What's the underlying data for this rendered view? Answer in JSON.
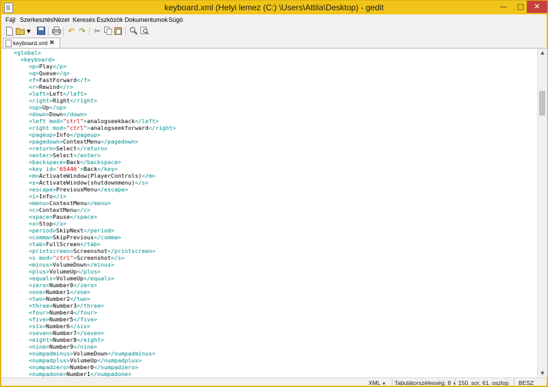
{
  "window": {
    "title": "keyboard.xml (Helyi lemez (C:) \\Users\\Attila\\Desktop) - gedit",
    "min_label": "—",
    "max_label": "□",
    "close_label": "✕"
  },
  "menu": [
    "Fájl",
    "Szerkesztés",
    "Nézet",
    "Keresés",
    "Eszközök",
    "Dokumentumok",
    "Súgó"
  ],
  "toolbar": {
    "icons": [
      "new-document-icon",
      "open-icon",
      "open-dropdown-icon",
      "save-icon",
      "print-icon",
      "undo-icon",
      "redo-icon",
      "cut-icon",
      "copy-icon",
      "paste-icon",
      "find-icon",
      "find-replace-icon"
    ]
  },
  "tab": {
    "label": "keyboard.xml",
    "close": "✖"
  },
  "lines": [
    [
      {
        "t": "tag",
        "s": "<global>"
      }
    ],
    [
      {
        "t": "tag",
        "s": "<keyboard>"
      }
    ],
    [
      {
        "t": "tag",
        "s": "<p>"
      },
      {
        "t": "txt",
        "s": "Play"
      },
      {
        "t": "tag",
        "s": "</p>"
      }
    ],
    [
      {
        "t": "tag",
        "s": "<q>"
      },
      {
        "t": "txt",
        "s": "Queue"
      },
      {
        "t": "tag",
        "s": "</q>"
      }
    ],
    [
      {
        "t": "tag",
        "s": "<f>"
      },
      {
        "t": "txt",
        "s": "FastForward"
      },
      {
        "t": "tag",
        "s": "</f>"
      }
    ],
    [
      {
        "t": "tag",
        "s": "<r>"
      },
      {
        "t": "txt",
        "s": "Rewind"
      },
      {
        "t": "tag",
        "s": "</r>"
      }
    ],
    [
      {
        "t": "tag",
        "s": "<left>"
      },
      {
        "t": "txt",
        "s": "Left"
      },
      {
        "t": "tag",
        "s": "</left>"
      }
    ],
    [
      {
        "t": "tag",
        "s": "<right>"
      },
      {
        "t": "txt",
        "s": "Right"
      },
      {
        "t": "tag",
        "s": "</right>"
      }
    ],
    [
      {
        "t": "tag",
        "s": "<up>"
      },
      {
        "t": "txt",
        "s": "Up"
      },
      {
        "t": "tag",
        "s": "</up>"
      }
    ],
    [
      {
        "t": "tag",
        "s": "<down>"
      },
      {
        "t": "txt",
        "s": "Down"
      },
      {
        "t": "tag",
        "s": "</down>"
      }
    ],
    [
      {
        "t": "tag",
        "s": "<left "
      },
      {
        "t": "attr",
        "s": "mod="
      },
      {
        "t": "val",
        "s": "\"ctrl\""
      },
      {
        "t": "tag",
        "s": ">"
      },
      {
        "t": "txt",
        "s": "analogseekback"
      },
      {
        "t": "tag",
        "s": "</left>"
      }
    ],
    [
      {
        "t": "tag",
        "s": "<right "
      },
      {
        "t": "attr",
        "s": "mod="
      },
      {
        "t": "val",
        "s": "\"ctrl\""
      },
      {
        "t": "tag",
        "s": ">"
      },
      {
        "t": "txt",
        "s": "analogseekforward"
      },
      {
        "t": "tag",
        "s": "</right>"
      }
    ],
    [
      {
        "t": "tag",
        "s": "<pageup>"
      },
      {
        "t": "txt",
        "s": "Info"
      },
      {
        "t": "tag",
        "s": "</pageup>"
      }
    ],
    [
      {
        "t": "tag",
        "s": "<pagedown>"
      },
      {
        "t": "txt",
        "s": "ContextMenu"
      },
      {
        "t": "tag",
        "s": "</pagedown>"
      }
    ],
    [
      {
        "t": "tag",
        "s": "<return>"
      },
      {
        "t": "txt",
        "s": "Select"
      },
      {
        "t": "tag",
        "s": "</return>"
      }
    ],
    [
      {
        "t": "tag",
        "s": "<enter>"
      },
      {
        "t": "txt",
        "s": "Select"
      },
      {
        "t": "tag",
        "s": "</enter>"
      }
    ],
    [
      {
        "t": "tag",
        "s": "<backspace>"
      },
      {
        "t": "txt",
        "s": "Back"
      },
      {
        "t": "tag",
        "s": "</backspace>"
      }
    ],
    [
      {
        "t": "tag",
        "s": "<key "
      },
      {
        "t": "attr",
        "s": "id="
      },
      {
        "t": "val",
        "s": "'65446'"
      },
      {
        "t": "tag",
        "s": ">"
      },
      {
        "t": "txt",
        "s": "Back"
      },
      {
        "t": "tag",
        "s": "</key>"
      }
    ],
    [
      {
        "t": "tag",
        "s": "<m>"
      },
      {
        "t": "txt",
        "s": "ActivateWindow(PlayerControls)"
      },
      {
        "t": "tag",
        "s": "</m>"
      }
    ],
    [
      {
        "t": "tag",
        "s": "<s>"
      },
      {
        "t": "txt",
        "s": "ActivateWindow(shutdownmenu)"
      },
      {
        "t": "tag",
        "s": "</s>"
      }
    ],
    [
      {
        "t": "tag",
        "s": "<escape>"
      },
      {
        "t": "txt",
        "s": "PreviousMenu"
      },
      {
        "t": "tag",
        "s": "</escape>"
      }
    ],
    [
      {
        "t": "tag",
        "s": "<i>"
      },
      {
        "t": "txt",
        "s": "Info"
      },
      {
        "t": "tag",
        "s": "</i>"
      }
    ],
    [
      {
        "t": "tag",
        "s": "<menu>"
      },
      {
        "t": "txt",
        "s": "ContextMenu"
      },
      {
        "t": "tag",
        "s": "</menu>"
      }
    ],
    [
      {
        "t": "tag",
        "s": "<c>"
      },
      {
        "t": "txt",
        "s": "ContextMenu"
      },
      {
        "t": "tag",
        "s": "</c>"
      }
    ],
    [
      {
        "t": "tag",
        "s": "<space>"
      },
      {
        "t": "txt",
        "s": "Pause"
      },
      {
        "t": "tag",
        "s": "</space>"
      }
    ],
    [
      {
        "t": "tag",
        "s": "<x>"
      },
      {
        "t": "txt",
        "s": "Stop"
      },
      {
        "t": "tag",
        "s": "</x>"
      }
    ],
    [
      {
        "t": "tag",
        "s": "<period>"
      },
      {
        "t": "txt",
        "s": "SkipNext"
      },
      {
        "t": "tag",
        "s": "</period>"
      }
    ],
    [
      {
        "t": "tag",
        "s": "<comma>"
      },
      {
        "t": "txt",
        "s": "SkipPrevious"
      },
      {
        "t": "tag",
        "s": "</comma>"
      }
    ],
    [
      {
        "t": "tag",
        "s": "<tab>"
      },
      {
        "t": "txt",
        "s": "FullScreen"
      },
      {
        "t": "tag",
        "s": "</tab>"
      }
    ],
    [
      {
        "t": "tag",
        "s": "<printscreen>"
      },
      {
        "t": "txt",
        "s": "Screenshot"
      },
      {
        "t": "tag",
        "s": "</printscreen>"
      }
    ],
    [
      {
        "t": "tag",
        "s": "<s "
      },
      {
        "t": "attr",
        "s": "mod="
      },
      {
        "t": "val",
        "s": "\"ctrl\""
      },
      {
        "t": "tag",
        "s": ">"
      },
      {
        "t": "txt",
        "s": "Screenshot"
      },
      {
        "t": "tag",
        "s": "</s>"
      }
    ],
    [
      {
        "t": "tag",
        "s": "<minus>"
      },
      {
        "t": "txt",
        "s": "VolumeDown"
      },
      {
        "t": "tag",
        "s": "</minus>"
      }
    ],
    [
      {
        "t": "tag",
        "s": "<plus>"
      },
      {
        "t": "txt",
        "s": "VolumeUp"
      },
      {
        "t": "tag",
        "s": "</plus>"
      }
    ],
    [
      {
        "t": "tag",
        "s": "<equals>"
      },
      {
        "t": "txt",
        "s": "VolumeUp"
      },
      {
        "t": "tag",
        "s": "</equals>"
      }
    ],
    [
      {
        "t": "tag",
        "s": "<zero>"
      },
      {
        "t": "txt",
        "s": "Number0"
      },
      {
        "t": "tag",
        "s": "</zero>"
      }
    ],
    [
      {
        "t": "tag",
        "s": "<one>"
      },
      {
        "t": "txt",
        "s": "Number1"
      },
      {
        "t": "tag",
        "s": "</one>"
      }
    ],
    [
      {
        "t": "tag",
        "s": "<two>"
      },
      {
        "t": "txt",
        "s": "Number2"
      },
      {
        "t": "tag",
        "s": "</two>"
      }
    ],
    [
      {
        "t": "tag",
        "s": "<three>"
      },
      {
        "t": "txt",
        "s": "Number3"
      },
      {
        "t": "tag",
        "s": "</three>"
      }
    ],
    [
      {
        "t": "tag",
        "s": "<four>"
      },
      {
        "t": "txt",
        "s": "Number4"
      },
      {
        "t": "tag",
        "s": "</four>"
      }
    ],
    [
      {
        "t": "tag",
        "s": "<five>"
      },
      {
        "t": "txt",
        "s": "Number5"
      },
      {
        "t": "tag",
        "s": "</five>"
      }
    ],
    [
      {
        "t": "tag",
        "s": "<six>"
      },
      {
        "t": "txt",
        "s": "Number6"
      },
      {
        "t": "tag",
        "s": "</six>"
      }
    ],
    [
      {
        "t": "tag",
        "s": "<seven>"
      },
      {
        "t": "txt",
        "s": "Number7"
      },
      {
        "t": "tag",
        "s": "</seven>"
      }
    ],
    [
      {
        "t": "tag",
        "s": "<eight>"
      },
      {
        "t": "txt",
        "s": "Number8"
      },
      {
        "t": "tag",
        "s": "</eight>"
      }
    ],
    [
      {
        "t": "tag",
        "s": "<nine>"
      },
      {
        "t": "txt",
        "s": "Number9"
      },
      {
        "t": "tag",
        "s": "</nine>"
      }
    ],
    [
      {
        "t": "tag",
        "s": "<numpadminus>"
      },
      {
        "t": "txt",
        "s": "VolumeDown"
      },
      {
        "t": "tag",
        "s": "</numpadminus>"
      }
    ],
    [
      {
        "t": "tag",
        "s": "<numpadplus>"
      },
      {
        "t": "txt",
        "s": "VolumeUp"
      },
      {
        "t": "tag",
        "s": "</numpadplus>"
      }
    ],
    [
      {
        "t": "tag",
        "s": "<numpadzero>"
      },
      {
        "t": "txt",
        "s": "Number0"
      },
      {
        "t": "tag",
        "s": "</numpadzero>"
      }
    ],
    [
      {
        "t": "tag",
        "s": "<numpadone>"
      },
      {
        "t": "txt",
        "s": "Number1"
      },
      {
        "t": "tag",
        "s": "</numpadone>"
      }
    ]
  ],
  "statusbar": {
    "language": "XML",
    "tab_width": "Tabulátorszélesség:  8",
    "position": "150. sor, 61. oszlop",
    "mode": "BESZ"
  },
  "colors": {
    "title_bar": "#f0c419",
    "xml_tag": "#008a8c",
    "xml_attr_value": "#c00000"
  }
}
